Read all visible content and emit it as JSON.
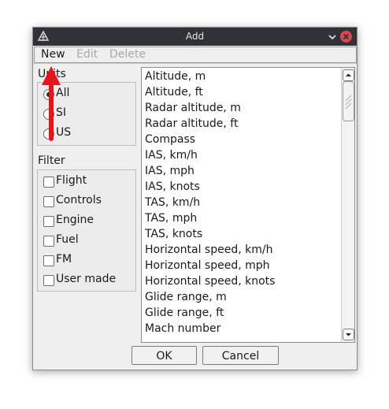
{
  "window": {
    "title": "Add"
  },
  "menu": {
    "new": "New",
    "edit": "Edit",
    "delete": "Delete"
  },
  "units": {
    "label": "Units",
    "options": [
      {
        "label": "All",
        "selected": true
      },
      {
        "label": "SI",
        "selected": false
      },
      {
        "label": "US",
        "selected": false
      }
    ]
  },
  "filter": {
    "label": "Filter",
    "options": [
      {
        "label": "Flight",
        "checked": false
      },
      {
        "label": "Controls",
        "checked": false
      },
      {
        "label": "Engine",
        "checked": false
      },
      {
        "label": "Fuel",
        "checked": false
      },
      {
        "label": "FM",
        "checked": false
      },
      {
        "label": "User made",
        "checked": false
      }
    ]
  },
  "list": {
    "items": [
      "Altitude, m",
      "Altitude, ft",
      "Radar altitude, m",
      "Radar altitude, ft",
      "Compass",
      "IAS, km/h",
      "IAS, mph",
      "IAS, knots",
      "TAS, km/h",
      "TAS, mph",
      "TAS, knots",
      "Horizontal speed, km/h",
      "Horizontal speed, mph",
      "Horizontal speed, knots",
      "Glide range, m",
      "Glide range, ft",
      "Mach number"
    ]
  },
  "buttons": {
    "ok": "OK",
    "cancel": "Cancel"
  },
  "colors": {
    "annotation_arrow": "#e8141b",
    "close_button": "#e0464f",
    "titlebar": "#2f3236"
  },
  "icons": {
    "app": "kde-app-icon",
    "minimize": "chevron-down-icon",
    "close": "close-icon"
  }
}
